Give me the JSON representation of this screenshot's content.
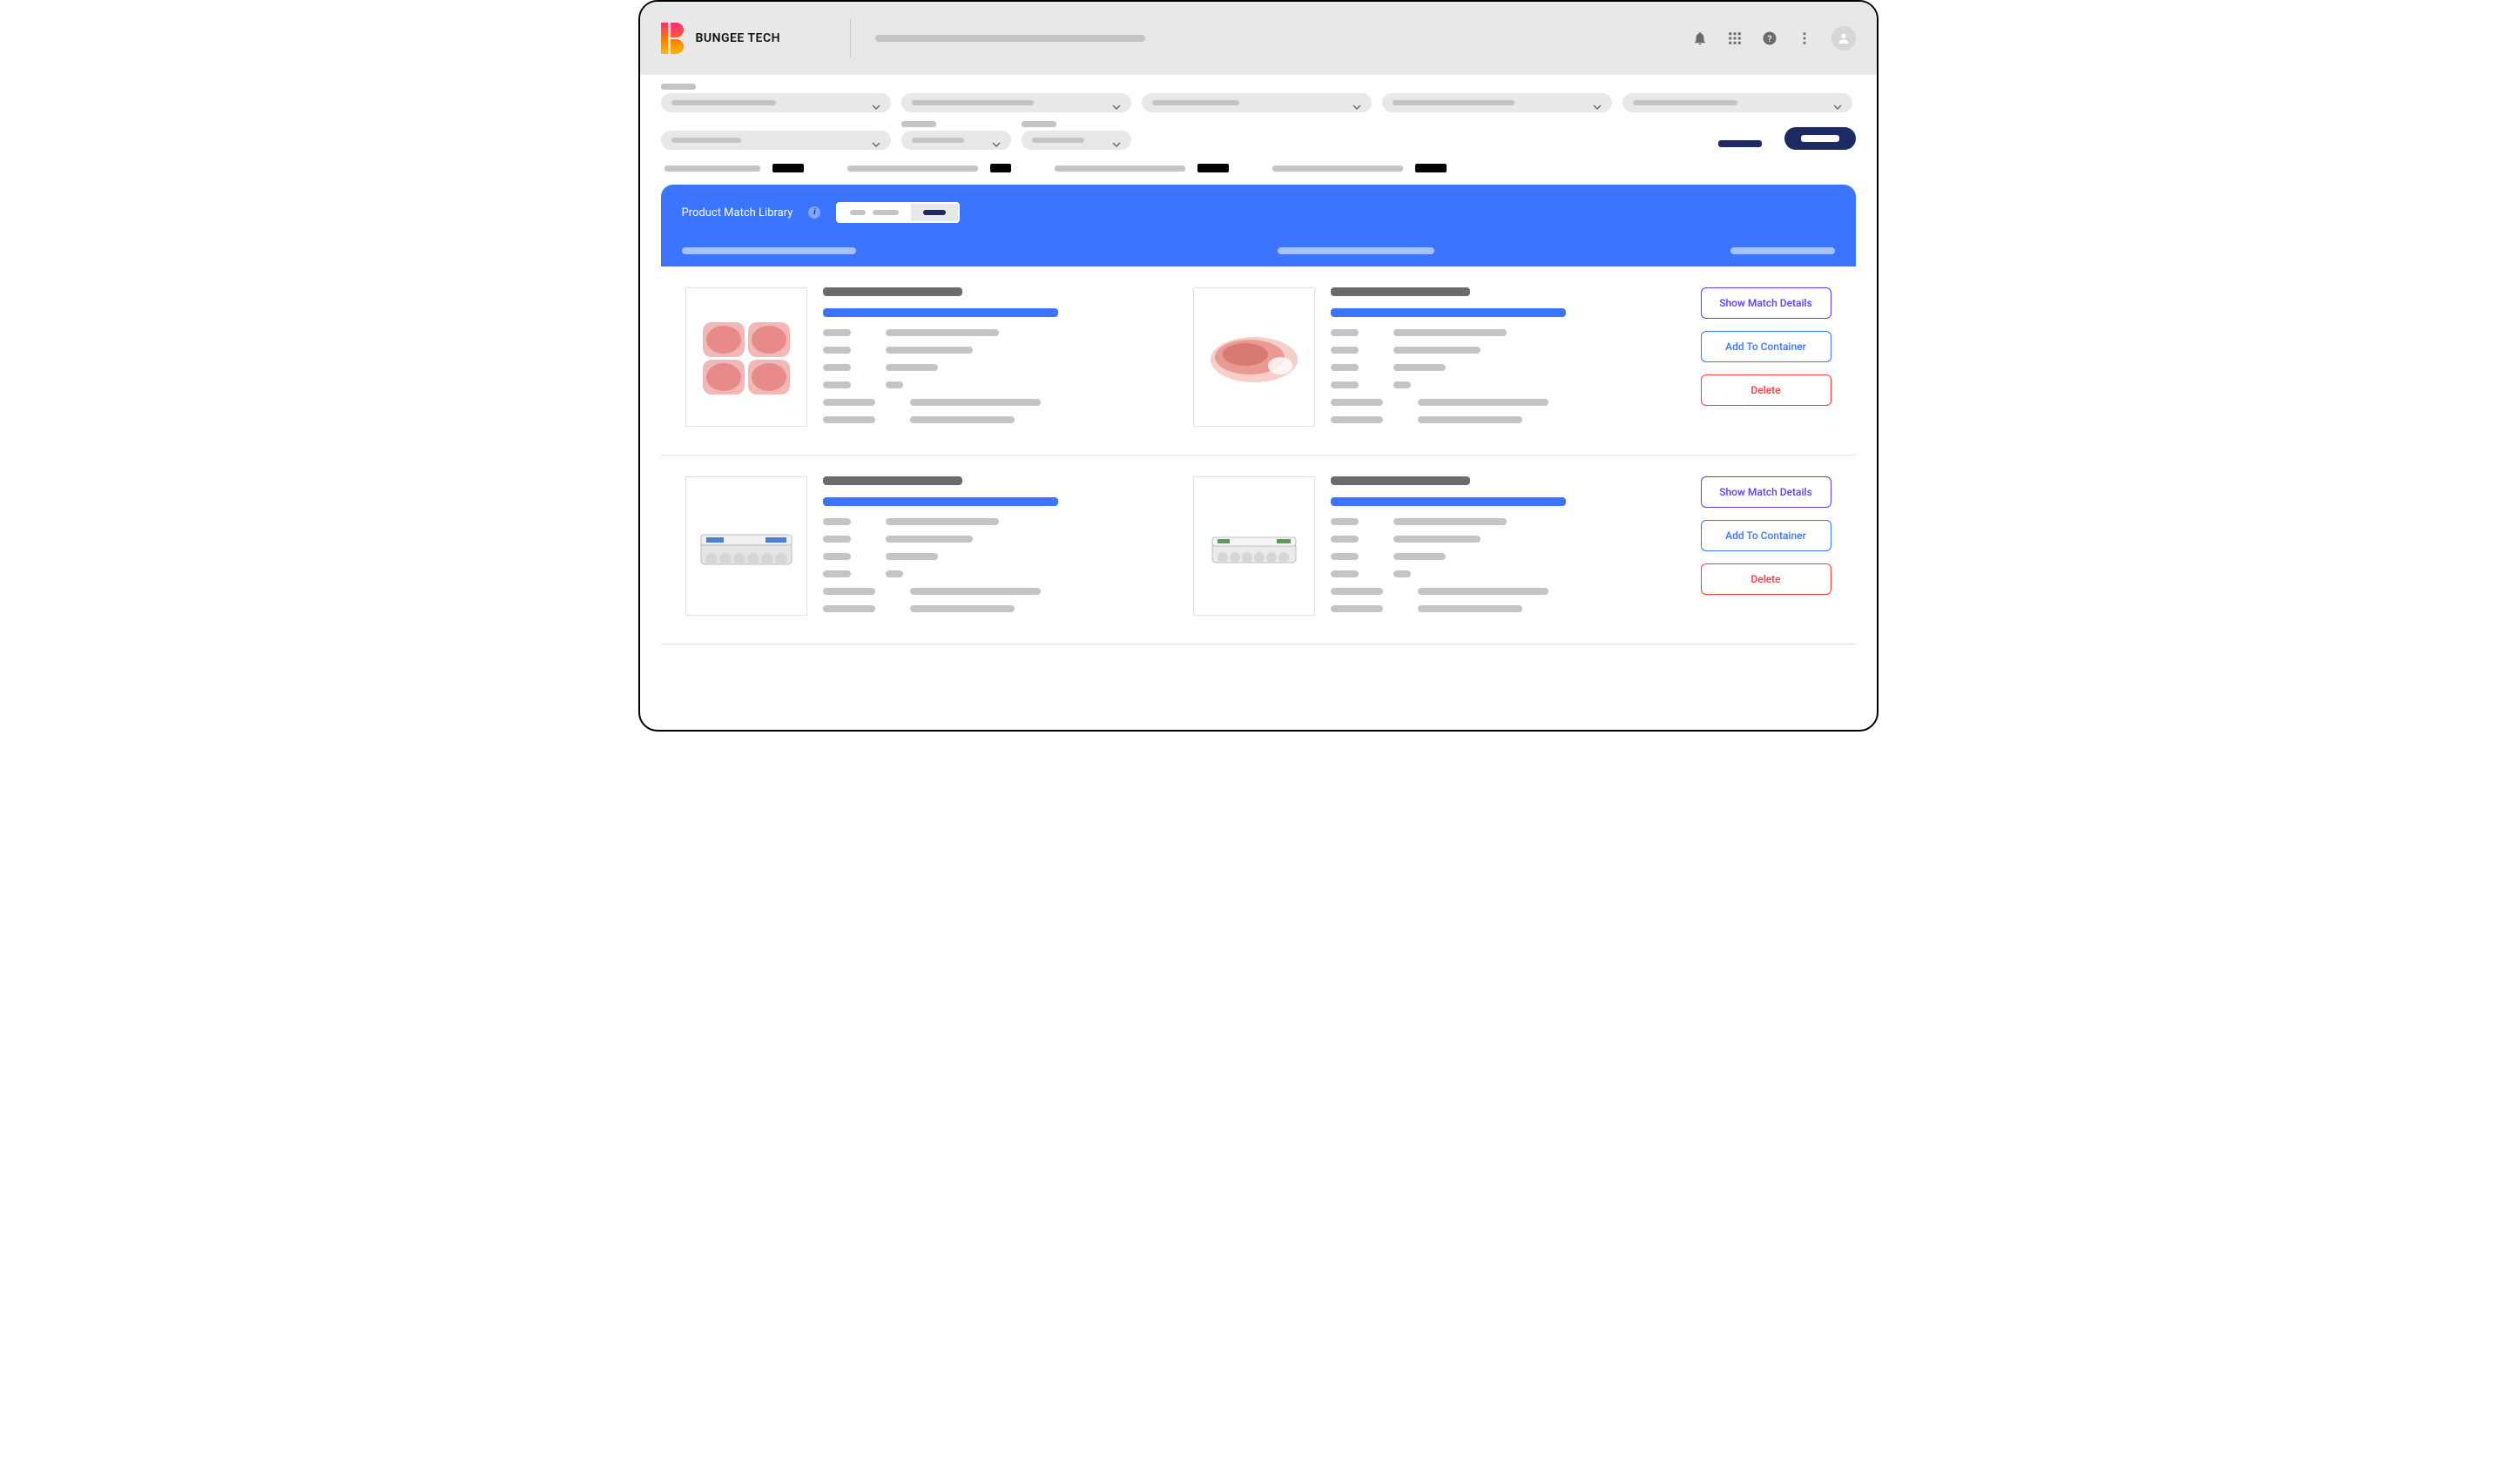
{
  "header": {
    "brand": "BUNGEE TECH",
    "icons": {
      "bell": "notifications-icon",
      "grid": "apps-icon",
      "help": "help-icon",
      "more": "more-vert-icon",
      "avatar": "avatar-icon"
    }
  },
  "library": {
    "title": "Product Match Library"
  },
  "actions": {
    "show_details": "Show Match Details",
    "add_container": "Add To Container",
    "delete": "Delete"
  },
  "rows": [
    {
      "id": "row-1",
      "thumb_left": "pork-chops",
      "thumb_right": "pork-loin"
    },
    {
      "id": "row-2",
      "thumb_left": "egg-carton",
      "thumb_right": "egg-carton"
    }
  ]
}
